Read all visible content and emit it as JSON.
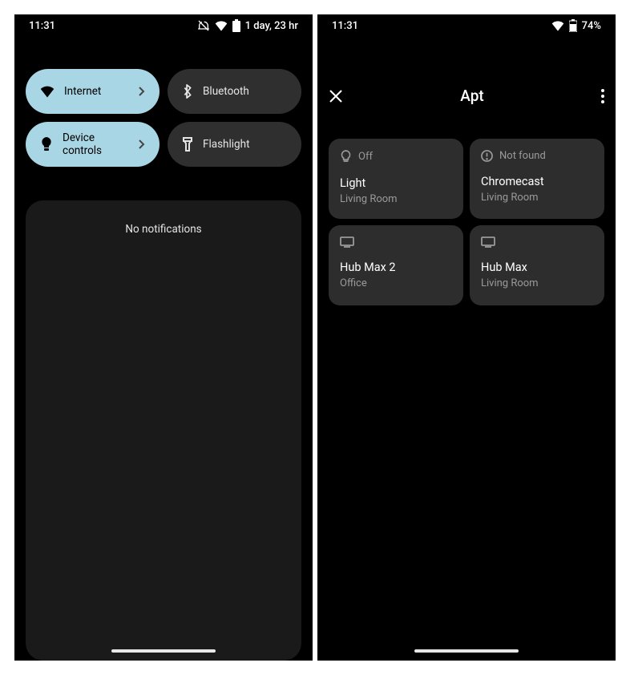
{
  "left": {
    "status_bar": {
      "time": "11:31",
      "battery_text": "1 day, 23 hr"
    },
    "quick_settings": [
      {
        "id": "internet",
        "label": "Internet",
        "active": true,
        "has_chevron": true,
        "icon": "wifi-icon"
      },
      {
        "id": "bluetooth",
        "label": "Bluetooth",
        "active": false,
        "has_chevron": false,
        "icon": "bluetooth-icon"
      },
      {
        "id": "device-controls",
        "label": "Device controls",
        "active": true,
        "has_chevron": true,
        "icon": "bulb-icon"
      },
      {
        "id": "flashlight",
        "label": "Flashlight",
        "active": false,
        "has_chevron": false,
        "icon": "flashlight-icon"
      }
    ],
    "notifications": {
      "empty_text": "No notifications"
    }
  },
  "right": {
    "status_bar": {
      "time": "11:31",
      "battery_text": "74%"
    },
    "apt": {
      "title": "Apt",
      "devices": [
        {
          "status": "Off",
          "name": "Light",
          "room": "Living Room",
          "icon": "bulb-outline-icon"
        },
        {
          "status": "Not found",
          "name": "Chromecast",
          "room": "Living Room",
          "icon": "alert-icon"
        },
        {
          "status": "",
          "name": "Hub Max 2",
          "room": "Office",
          "icon": "screen-icon"
        },
        {
          "status": "",
          "name": "Hub Max",
          "room": "Living Room",
          "icon": "screen-icon"
        }
      ]
    }
  }
}
